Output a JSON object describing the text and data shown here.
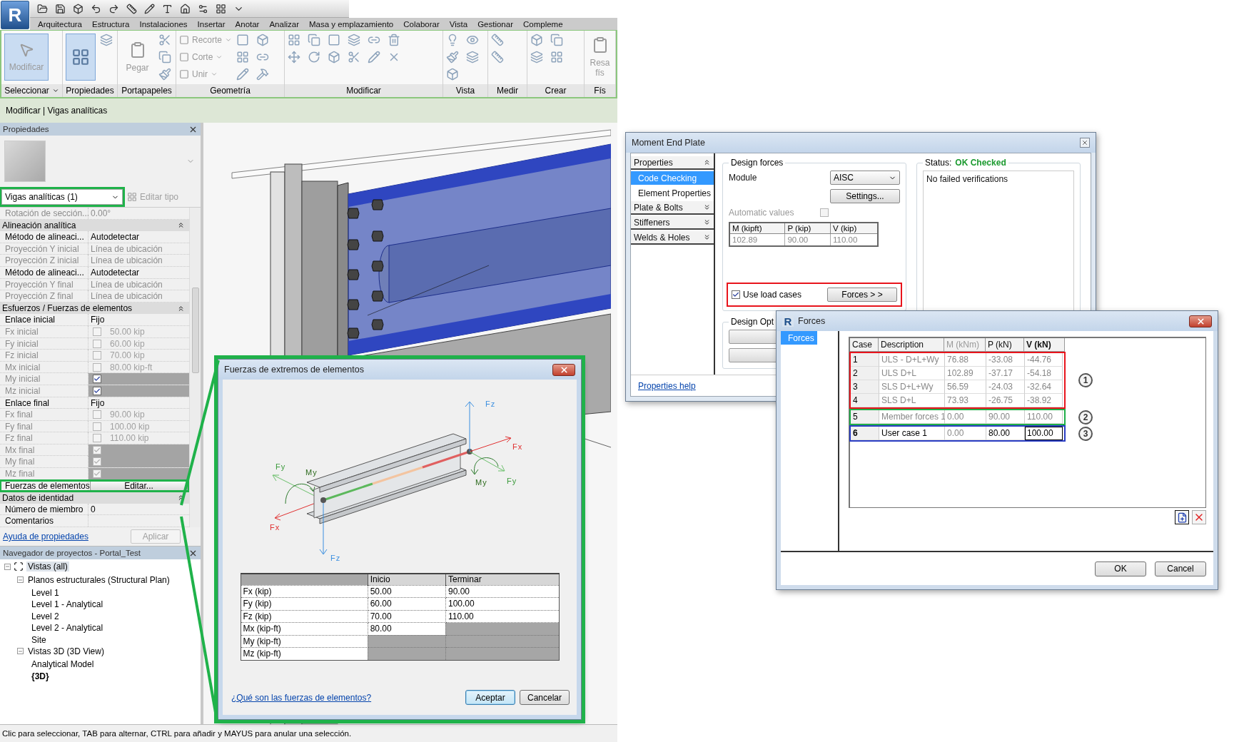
{
  "app": {
    "logo": "R",
    "tabs": [
      "Arquitectura",
      "Estructura",
      "Instalaciones",
      "Insertar",
      "Anotar",
      "Analizar",
      "Masa y emplazamiento",
      "Colaborar",
      "Vista",
      "Gestionar",
      "Compleme"
    ],
    "panels": [
      {
        "title": "Seleccionar",
        "dropdown": true,
        "tools": [
          {
            "label": "Modificar",
            "kind": "large",
            "selected": true,
            "disabled": true
          }
        ]
      },
      {
        "title": "Propiedades",
        "dropdown": false,
        "tools": [
          {
            "kind": "large_icon",
            "selected": true
          }
        ]
      },
      {
        "title": "Portapapeles",
        "dropdown": false,
        "tools": [
          {
            "label": "Pegar",
            "kind": "large",
            "selected": false,
            "disabled": true
          }
        ]
      },
      {
        "title": "Geometría",
        "dropdown": false,
        "tools": [
          {
            "label": "Recorte",
            "kind": "small",
            "disabled": true
          },
          {
            "label": "Corte",
            "kind": "small",
            "disabled": true
          },
          {
            "label": "Unir",
            "kind": "small",
            "disabled": true
          }
        ]
      },
      {
        "title": "Modificar",
        "dropdown": false
      },
      {
        "title": "Vista",
        "dropdown": false
      },
      {
        "title": "Medir",
        "dropdown": false
      },
      {
        "title": "Crear",
        "dropdown": false
      },
      {
        "title": "Fís",
        "dropdown": false,
        "tools": [
          {
            "label": "Resa fís",
            "kind": "large",
            "selected": false,
            "disabled": true
          }
        ]
      }
    ],
    "context_tab": "Modificar | Vigas analíticas"
  },
  "properties": {
    "title": "Propiedades",
    "type": "Vigas analíticas (1)",
    "type_highlighted": true,
    "edit_type": "Editar tipo",
    "rows": [
      {
        "kind": "value",
        "label": "Rotación de sección...",
        "value": "0.00°",
        "disabled": true
      },
      {
        "kind": "group",
        "label": "Alineación analítica",
        "expanded": true
      },
      {
        "kind": "value",
        "label": "Método de alineaci...",
        "value": "Autodetectar",
        "disabled": false
      },
      {
        "kind": "value",
        "label": "Proyección Y inicial",
        "value": "Línea de ubicación",
        "disabled": true
      },
      {
        "kind": "value",
        "label": "Proyección Z inicial",
        "value": "Línea de ubicación",
        "disabled": true
      },
      {
        "kind": "value",
        "label": "Método de alineaci...",
        "value": "Autodetectar",
        "disabled": false
      },
      {
        "kind": "value",
        "label": "Proyección Y final",
        "value": "Línea de ubicación",
        "disabled": true
      },
      {
        "kind": "value",
        "label": "Proyección Z final",
        "value": "Línea de ubicación",
        "disabled": true
      },
      {
        "kind": "group",
        "label": "Esfuerzos / Fuerzas de elementos",
        "expanded": true
      },
      {
        "kind": "value",
        "label": "Enlace inicial",
        "value": "Fijo",
        "disabled": false
      },
      {
        "kind": "check",
        "label": "Fx inicial",
        "checked": false,
        "value": "50.00 kip",
        "shaded": false,
        "check_enabled": false
      },
      {
        "kind": "check",
        "label": "Fy inicial",
        "checked": false,
        "value": "60.00 kip",
        "shaded": false,
        "check_enabled": false
      },
      {
        "kind": "check",
        "label": "Fz inicial",
        "checked": false,
        "value": "70.00 kip",
        "shaded": false,
        "check_enabled": false
      },
      {
        "kind": "check",
        "label": "Mx inicial",
        "checked": false,
        "value": "80.00 kip-ft",
        "shaded": false,
        "check_enabled": false
      },
      {
        "kind": "check",
        "label": "My inicial",
        "checked": true,
        "shaded": true,
        "check_enabled": true
      },
      {
        "kind": "check",
        "label": "Mz inicial",
        "checked": true,
        "shaded": true,
        "check_enabled": true
      },
      {
        "kind": "value",
        "label": "Enlace final",
        "value": "Fijo",
        "disabled": false
      },
      {
        "kind": "check",
        "label": "Fx final",
        "checked": false,
        "value": "90.00 kip",
        "shaded": false,
        "check_enabled": false
      },
      {
        "kind": "check",
        "label": "Fy final",
        "checked": false,
        "value": "100.00 kip",
        "shaded": false,
        "check_enabled": false
      },
      {
        "kind": "check",
        "label": "Fz final",
        "checked": false,
        "value": "110.00 kip",
        "shaded": false,
        "check_enabled": false
      },
      {
        "kind": "check",
        "label": "Mx final",
        "checked": true,
        "shaded": true,
        "check_enabled": false
      },
      {
        "kind": "check",
        "label": "My final",
        "checked": true,
        "shaded": true,
        "check_enabled": false
      },
      {
        "kind": "check",
        "label": "Mz final",
        "checked": true,
        "shaded": true,
        "check_enabled": false
      },
      {
        "kind": "button",
        "label": "Fuerzas de elementos",
        "button": "Editar...",
        "highlighted": true
      },
      {
        "kind": "group",
        "label": "Datos de identidad",
        "expanded": true
      },
      {
        "kind": "value",
        "label": "Número de miembro",
        "value": "0",
        "disabled": false
      },
      {
        "kind": "value",
        "label": "Comentarios",
        "disabled": false
      }
    ],
    "help_link": "Ayuda de propiedades",
    "apply": "Aplicar"
  },
  "browser": {
    "title": "Navegador de proyectos - Portal_Test",
    "tree": [
      {
        "label": "Vistas (all)",
        "selected": true,
        "expanded": true,
        "children": [
          {
            "label": "Planos estructurales (Structural Plan)",
            "selected": false,
            "expanded": true,
            "children": [
              {
                "label": "Level 1",
                "selected": false
              },
              {
                "label": "Level 1 - Analytical",
                "selected": false
              },
              {
                "label": "Level 2",
                "selected": false
              },
              {
                "label": "Level 2 - Analytical",
                "selected": false
              },
              {
                "label": "Site",
                "selected": false
              }
            ]
          },
          {
            "label": "Vistas 3D (3D View)",
            "selected": false,
            "expanded": true,
            "children": [
              {
                "label": "Analytical Model",
                "selected": false,
                "current": false
              },
              {
                "label": "{3D}",
                "selected": false,
                "current": true
              }
            ]
          }
        ]
      }
    ]
  },
  "status_bar": "Clic para seleccionar, TAB para alternar, CTRL para añadir y MAYUS para anular una selección.",
  "member_forces_dialog": {
    "title": "Fuerzas de extremos de elementos",
    "diagram_labels": [
      "Fz",
      "Fx",
      "Fy",
      "My",
      "My",
      "Fy",
      "Fx",
      "Fz"
    ],
    "columns": [
      "Inicio",
      "Terminar"
    ],
    "rows": [
      {
        "label": "Fx (kip)",
        "start": {
          "value": "50.00",
          "enabled": true
        },
        "end": {
          "value": "90.00",
          "enabled": true
        }
      },
      {
        "label": "Fy (kip)",
        "start": {
          "value": "60.00",
          "enabled": true
        },
        "end": {
          "value": "100.00",
          "enabled": true
        }
      },
      {
        "label": "Fz (kip)",
        "start": {
          "value": "70.00",
          "enabled": true
        },
        "end": {
          "value": "110.00",
          "enabled": true
        }
      },
      {
        "label": "Mx (kip-ft)",
        "start": {
          "value": "80.00",
          "enabled": true
        },
        "end": {
          "enabled": false
        }
      },
      {
        "label": "My (kip-ft)",
        "start": {
          "enabled": false
        },
        "end": {
          "enabled": false
        }
      },
      {
        "label": "Mz (kip-ft)",
        "start": {
          "enabled": false
        },
        "end": {
          "enabled": false
        }
      }
    ],
    "help_link": "¿Qué son las fuerzas de elementos?",
    "buttons": [
      {
        "label": "Aceptar",
        "default": true
      },
      {
        "label": "Cancelar",
        "default": false
      }
    ]
  },
  "moment_dialog": {
    "title": "Moment End Plate",
    "nav": [
      {
        "label": "Properties",
        "kind": "header",
        "expanded": true
      },
      {
        "label": "Code Checking",
        "kind": "item",
        "selected": true
      },
      {
        "label": "Element Properties",
        "kind": "item",
        "selected": false
      },
      {
        "label": "Plate & Bolts",
        "kind": "header",
        "expanded": false
      },
      {
        "label": "Stiffeners",
        "kind": "header",
        "expanded": false
      },
      {
        "label": "Welds & Holes",
        "kind": "header",
        "expanded": false
      }
    ],
    "design_forces": {
      "title": "Design forces",
      "module_label": "Module",
      "module": "AISC",
      "settings": "Settings...",
      "auto_label": "Automatic values",
      "auto_checked": false,
      "columns": [
        "M (kipft)",
        "P (kip)",
        "V (kip)"
      ],
      "values": [
        "102.89",
        "90.00",
        "110.00"
      ],
      "use_load_cases": {
        "label": "Use load cases",
        "checked": true,
        "highlighted": true
      },
      "forces_button": "Forces > >"
    },
    "design_options": {
      "title": "Design Opt"
    },
    "status": {
      "label": "Status:",
      "value": "OK Checked",
      "message": "No failed verifications"
    },
    "help_link": "Properties help"
  },
  "forces_dialog": {
    "logo": "R",
    "title": "Forces",
    "nav": [
      {
        "label": "Forces",
        "selected": true
      }
    ],
    "columns": [
      {
        "label": "Case",
        "disabled": false,
        "selected": false
      },
      {
        "label": "Description",
        "disabled": false,
        "selected": false
      },
      {
        "label": "M (kNm)",
        "disabled": true,
        "selected": false
      },
      {
        "label": "P (kN)",
        "disabled": false,
        "selected": false
      },
      {
        "label": "V (kN)",
        "disabled": false,
        "selected": true
      }
    ],
    "groups": [
      {
        "callout": "1",
        "color": "#e8141c",
        "rows": [
          {
            "case": "1",
            "description": "ULS - D+L+Wy",
            "m": "76.88",
            "p": "-33.08",
            "v": "-44.76",
            "editable": false,
            "current": false
          },
          {
            "case": "2",
            "description": "ULS D+L",
            "m": "102.89",
            "p": "-37.17",
            "v": "-54.18",
            "editable": false,
            "current": false
          },
          {
            "case": "3",
            "description": "SLS D+L+Wy",
            "m": "56.59",
            "p": "-24.03",
            "v": "-32.64",
            "editable": false,
            "current": false
          },
          {
            "case": "4",
            "description": "SLS D+L",
            "m": "73.93",
            "p": "-26.75",
            "v": "-38.92",
            "editable": false,
            "current": false
          }
        ]
      },
      {
        "callout": "2",
        "color": "#1fae48",
        "rows": [
          {
            "case": "5",
            "description": "Member forces 1",
            "m": "0.00",
            "p": "90.00",
            "v": "110.00",
            "editable": false,
            "current": false
          }
        ]
      },
      {
        "callout": "3",
        "color": "#2b3ec4",
        "rows": [
          {
            "case": "6",
            "description": "User case 1",
            "m": "0.00",
            "p": "80.00",
            "v": "100.00",
            "editable": true,
            "current": true
          }
        ]
      }
    ],
    "buttons": [
      "OK",
      "Cancel"
    ]
  }
}
